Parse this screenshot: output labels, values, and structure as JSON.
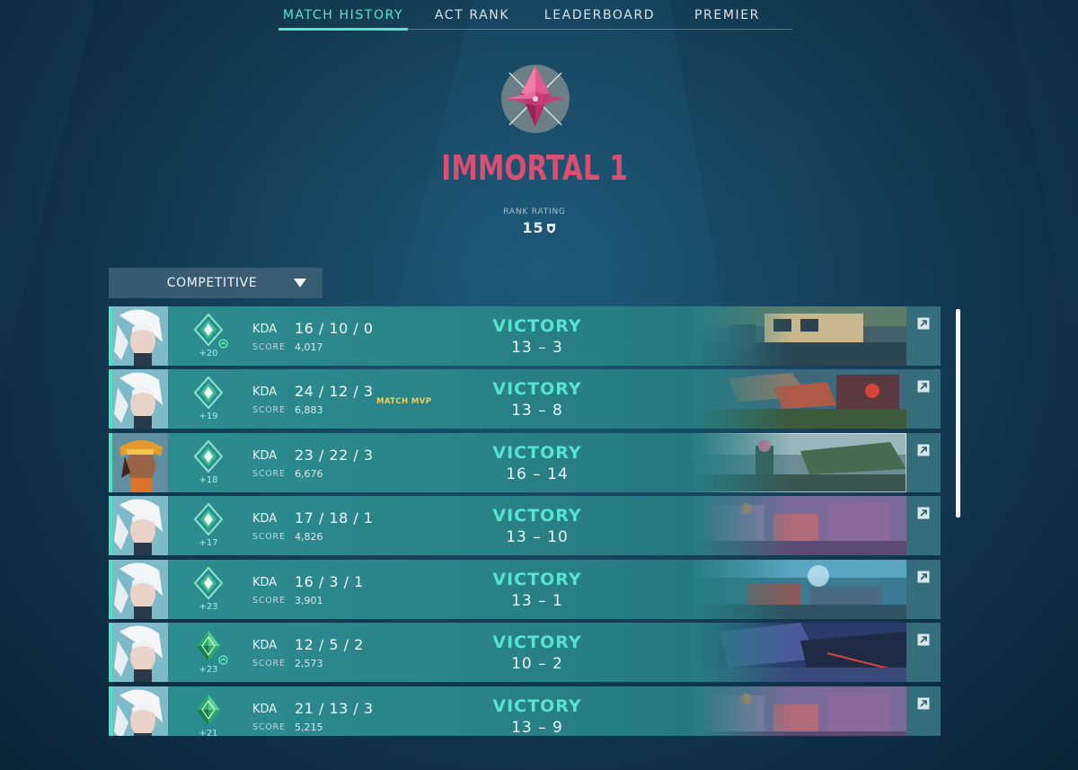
{
  "nav": {
    "tabs": [
      {
        "label": "MATCH HISTORY",
        "active": true
      },
      {
        "label": "ACT RANK",
        "active": false
      },
      {
        "label": "LEADERBOARD",
        "active": false
      },
      {
        "label": "PREMIER",
        "active": false
      }
    ]
  },
  "rank": {
    "title": "IMMORTAL 1",
    "rating_label": "RANK RATING",
    "rating_value": "15",
    "color": "#d94e71"
  },
  "queue": {
    "selected": "COMPETITIVE"
  },
  "colors": {
    "accent": "#56e4cf",
    "victory": "#56e4cf",
    "mvp": "#f0cf5a"
  },
  "matches": [
    {
      "agent": "jett",
      "rr_change": "+20",
      "kda_label": "KDA",
      "kda": "16 / 10 / 0",
      "score_label": "SCORE",
      "score": "4,017",
      "mvp": "",
      "result": "VICTORY",
      "rounds": "13 – 3",
      "map": "map-1",
      "rank_badge": "ascendant-icon",
      "promo": true
    },
    {
      "agent": "jett",
      "rr_change": "+19",
      "kda_label": "KDA",
      "kda": "24 / 12 / 3",
      "score_label": "SCORE",
      "score": "6,883",
      "mvp": "MATCH MVP",
      "result": "VICTORY",
      "rounds": "13 – 8",
      "map": "map-2",
      "rank_badge": "ascendant-icon",
      "promo": false
    },
    {
      "agent": "raze",
      "rr_change": "+18",
      "kda_label": "KDA",
      "kda": "23 / 22 / 3",
      "score_label": "SCORE",
      "score": "6,676",
      "mvp": "",
      "result": "VICTORY",
      "rounds": "16 – 14",
      "map": "map-3",
      "rank_badge": "ascendant-icon",
      "promo": false
    },
    {
      "agent": "jett",
      "rr_change": "+17",
      "kda_label": "KDA",
      "kda": "17 / 18 / 1",
      "score_label": "SCORE",
      "score": "4,826",
      "mvp": "",
      "result": "VICTORY",
      "rounds": "13 – 10",
      "map": "map-4",
      "rank_badge": "ascendant-icon",
      "promo": false
    },
    {
      "agent": "jett",
      "rr_change": "+23",
      "kda_label": "KDA",
      "kda": "16 / 3 / 1",
      "score_label": "SCORE",
      "score": "3,901",
      "mvp": "",
      "result": "VICTORY",
      "rounds": "13 – 1",
      "map": "map-5",
      "rank_badge": "ascendant-icon",
      "promo": false
    },
    {
      "agent": "jett",
      "rr_change": "+23",
      "kda_label": "KDA",
      "kda": "12 / 5 / 2",
      "score_label": "SCORE",
      "score": "2,573",
      "mvp": "",
      "result": "VICTORY",
      "rounds": "10 – 2",
      "map": "map-6",
      "rank_badge": "diamond-icon",
      "promo": true
    },
    {
      "agent": "jett",
      "rr_change": "+21",
      "kda_label": "KDA",
      "kda": "21 / 13 / 3",
      "score_label": "SCORE",
      "score": "5,215",
      "mvp": "",
      "result": "VICTORY",
      "rounds": "13 – 9",
      "map": "map-7",
      "rank_badge": "diamond-icon",
      "promo": false
    }
  ]
}
